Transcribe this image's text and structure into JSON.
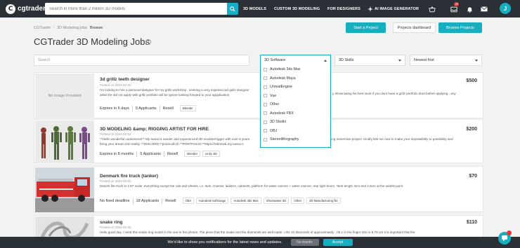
{
  "header": {
    "logo_letter": "C",
    "logo_text": "cgtrader",
    "search_placeholder": "Search in more than 2 million 3D models",
    "nav": [
      "3D MODELS",
      "CUSTOM 3D MODELING",
      "FOR DESIGNERS",
      "AI IMAGE GENERATOR"
    ],
    "notification_count": "20",
    "avatar_letter": "J"
  },
  "breadcrumb": [
    "CGTrader",
    "3D Modeling jobs",
    "Browse"
  ],
  "actions": {
    "start": "Start a Project",
    "dashboard": "Projects dashboard",
    "browse": "Browse Projects"
  },
  "page_title": "CGTrader 3D Modeling Jobs",
  "filters": {
    "search_placeholder": "Search",
    "software": "3D Software",
    "skills": "3D Skills",
    "sort": "Newest first"
  },
  "software_options": [
    "Autodesk 3ds Max",
    "Autodesk Maya",
    "UnrealEngine",
    "Vue",
    "Other",
    "Autodesk FBX",
    "3D Studio",
    "OBJ",
    "Stereolithography"
  ],
  "jobs": [
    {
      "title": "3d grillz teeth designer",
      "date": "Posted on 2023-02-04",
      "desc1": "I'm looking to hire a personal designer for my grillz workshop , seeking a very experienced grillz designer",
      "desc1b": "y showcasing his best work if you dont have a grillz portfolio dont bother applying , any",
      "desc2": "artist the did not apply with grillz portfolio will be ignore looking forward to your appplication",
      "price": "$500",
      "expires": "Expires in 6 days",
      "applicants": "9 Applicants",
      "resell": "Resell",
      "tags": [
        "Blender"
      ],
      "no_image": "No Image Provided"
    },
    {
      "title": "3D MODELING &amp; RIGGING ARTIST FOR HIRE",
      "date": "Posted on 2023-02-03",
      "desc1": "**Hello wonderful customers!!** My name is sander and experienced 3D modeler/rigger with over 5 years",
      "desc1b": "t pelivering immersive project. Kindly DM me now to make your impossibility to possibility and",
      "desc2": "bring your dream into reality. **DISCORD:**protocolb.th **PORTFOLIO:**https://rebnewd.my.canva.s",
      "price": "$200",
      "expires": "Expires in 8 months",
      "applicants": "5 Applicants",
      "resell": "Resell",
      "tags": [
        "Blender",
        "Unity 3D"
      ]
    },
    {
      "title": "Denmark fire truck (tanker)",
      "date": "Posted on 2023-02-03",
      "desc1": "Danish fire truck in 1:87 scale, everything except the cab and wheels, i.e. tank, chassis, ladders, cabinets, platform for water cannon + water cannon, rear light boom. Tank length 4cm and 2.5cm at the widest point.",
      "desc1b": "",
      "desc2": "",
      "price": "$70",
      "expires": "No fixed deadline",
      "applicants": "18 Applicants",
      "resell": "Resell",
      "tags": [
        "OBJ",
        "Autodesk Softimage",
        "Autodesk 3ds Max",
        "Shockwave 3D",
        "Other",
        "3D Manufacturing file"
      ]
    },
    {
      "title": "snake ring",
      "date": "Posted on 2023-02-03",
      "desc1": "Hello good day, i need this snake ring model in the one in the photos. The piece that the snake and the diamonds are well made. i the 10 diamonds of approximately , 05 1 in the finger size is 8.75 US it is important that the",
      "desc1b": "",
      "desc2": "",
      "price": "$110"
    }
  ],
  "cookie": {
    "text": "We'd like to show you notifications for the latest news and updates.",
    "decline": "No thanks",
    "accept": "Accept"
  }
}
